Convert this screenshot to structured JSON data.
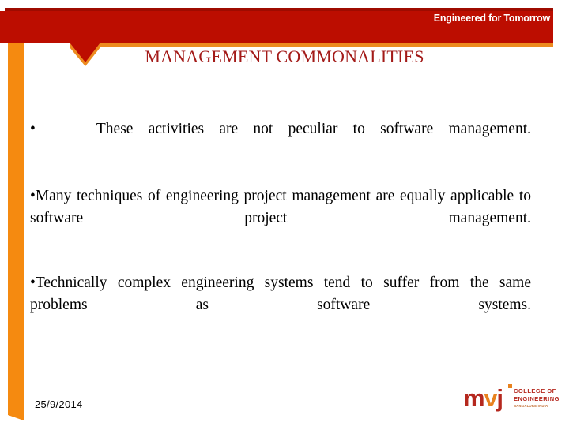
{
  "slide": {
    "title": "MANAGEMENT COMMONALITIES",
    "tagline": "Engineered for Tomorrow",
    "bullets": [
      {
        "marker": "•",
        "text": "These activities are not peculiar to software management.",
        "spaced_marker": true
      },
      {
        "marker": "•",
        "text": "Many techniques of engineering project management are equally applicable to software project management.",
        "spaced_marker": false
      },
      {
        "marker": "•",
        "text": "Technically complex engineering systems tend to suffer from the same problems as software systems.",
        "spaced_marker": false
      }
    ]
  },
  "footer": {
    "date": "25/9/2014",
    "logo": {
      "mark_m": "m",
      "mark_v": "v",
      "mark_j": "j",
      "line1": "COLLEGE OF",
      "line2": "ENGINEERING",
      "line3": "BANGALORE INDIA"
    }
  },
  "colors": {
    "header_red": "#BC0D00",
    "header_red_dark": "#9E0B00",
    "accent_orange": "#ED8B1F",
    "title_red": "#A31A18",
    "logo_red": "#B5281E",
    "logo_orange": "#E8821E",
    "body_text": "#000000",
    "background": "#FFFFFF"
  }
}
